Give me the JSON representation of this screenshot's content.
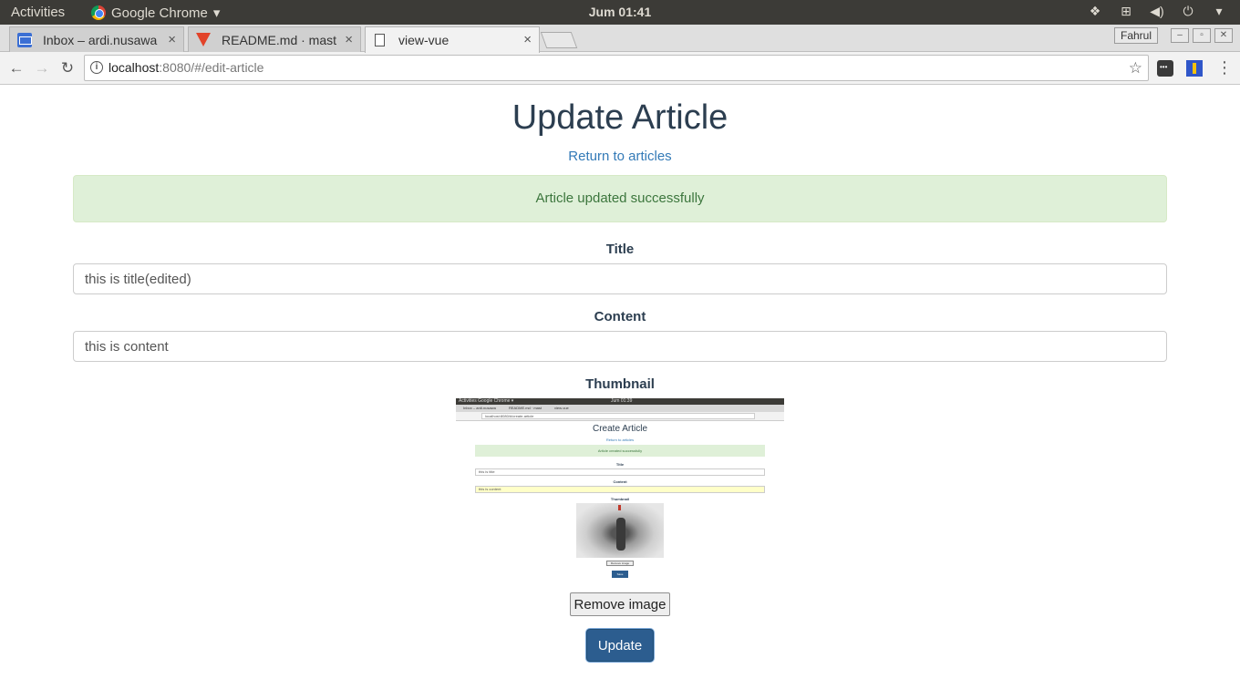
{
  "system_bar": {
    "activities": "Activities",
    "app_name": "Google Chrome",
    "app_menu_arrow": "▾",
    "clock": "Jum 01:41",
    "tray_icons": [
      "dropbox-icon",
      "network-icon",
      "volume-icon",
      "power-icon",
      "chevron-down-icon"
    ]
  },
  "browser": {
    "tabs": [
      {
        "title": "Inbox – ardi.nusawa",
        "icon": "mail-icon",
        "close": "×",
        "active": false
      },
      {
        "title": "README.md · mast",
        "icon": "gitlab-icon",
        "close": "×",
        "active": false
      },
      {
        "title": "view-vue",
        "icon": "page-icon",
        "close": "×",
        "active": true
      }
    ],
    "profile_name": "Fahrul",
    "address": {
      "host": "localhost",
      "rest": ":8080/#/edit-article"
    }
  },
  "page": {
    "title": "Update Article",
    "return_link": "Return to articles",
    "alert": "Article updated successfully",
    "fields": {
      "title_label": "Title",
      "title_value": "this is title(edited)",
      "content_label": "Content",
      "content_value": "this is content",
      "thumbnail_label": "Thumbnail"
    },
    "thumbnail_preview": {
      "bar_left": "Activities   Google Chrome ▾",
      "bar_clock": "Jum 01:39",
      "tab_1": "Inbox – ardi.nusawa",
      "tab_2": "README.md · mast",
      "tab_3": "view-vue",
      "address": "localhost:8080/#/create-article",
      "title": "Create Article",
      "return_link": "Return to articles",
      "alert": "Article created successfully",
      "title_label": "Title",
      "title_value": "this is title",
      "content_label": "Content",
      "content_value": "this is content",
      "thumbnail_label": "Thumbnail",
      "remove_button": "Remove image",
      "save_button": "Save"
    },
    "remove_image_button": "Remove image",
    "update_button": "Update"
  }
}
